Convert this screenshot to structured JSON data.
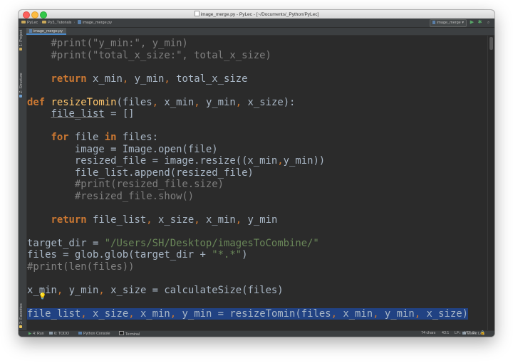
{
  "window": {
    "title": "image_merge.py - PyLec - [~/Documents/_Python/PyLec]"
  },
  "navbar": {
    "breadcrumbs": [
      "PyLec",
      "Py3_Tutorials",
      "image_merge.py"
    ],
    "run_config": "image_merge ▾",
    "run_icon": "run-icon",
    "debug_icon": "debug-icon",
    "search_icon": "search-icon"
  },
  "tabs": [
    {
      "label": "image_merge.py",
      "active": true
    }
  ],
  "left_tools": [
    {
      "label": "1: Project"
    },
    {
      "label": "Z: Structure"
    },
    {
      "label": "2: Favorites"
    }
  ],
  "editor": {
    "lines": [
      [
        [
          "cmt",
          "    #print(\"y_min:\", y_min)"
        ]
      ],
      [
        [
          "cmt",
          "    #print(\"total_x_size:\", total_x_size)"
        ]
      ],
      [
        [
          "plain",
          ""
        ]
      ],
      [
        [
          "plain",
          "    "
        ],
        [
          "kw",
          "return"
        ],
        [
          "plain",
          " x_min"
        ],
        [
          "kwn",
          ","
        ],
        [
          "plain",
          " y_min"
        ],
        [
          "kwn",
          ","
        ],
        [
          "plain",
          " total_x_size"
        ]
      ],
      [
        [
          "plain",
          ""
        ]
      ],
      [
        [
          "kw",
          "def"
        ],
        [
          "plain",
          " "
        ],
        [
          "fn",
          "resizeTomin"
        ],
        [
          "plain",
          "(files"
        ],
        [
          "kwn",
          ","
        ],
        [
          "plain",
          " x_min"
        ],
        [
          "kwn",
          ","
        ],
        [
          "plain",
          " y_min"
        ],
        [
          "kwn",
          ","
        ],
        [
          "plain",
          " x_size):"
        ]
      ],
      [
        [
          "plain",
          "    "
        ],
        [
          "unused",
          "file_list"
        ],
        [
          "plain",
          " = []"
        ]
      ],
      [
        [
          "plain",
          ""
        ]
      ],
      [
        [
          "plain",
          "    "
        ],
        [
          "kw",
          "for"
        ],
        [
          "plain",
          " file "
        ],
        [
          "kw",
          "in"
        ],
        [
          "plain",
          " files:"
        ]
      ],
      [
        [
          "plain",
          "        image = Image.open(file)"
        ]
      ],
      [
        [
          "plain",
          "        resized_file = image.resize((x_min"
        ],
        [
          "kwn",
          ","
        ],
        [
          "plain",
          "y_min))"
        ]
      ],
      [
        [
          "plain",
          "        file_list.append(resized_file)"
        ]
      ],
      [
        [
          "cmt",
          "        #print(resized_file.size)"
        ]
      ],
      [
        [
          "cmt",
          "        #resized_file.show()"
        ]
      ],
      [
        [
          "plain",
          ""
        ]
      ],
      [
        [
          "plain",
          "    "
        ],
        [
          "kw",
          "return"
        ],
        [
          "plain",
          " file_list"
        ],
        [
          "kwn",
          ","
        ],
        [
          "plain",
          " x_size"
        ],
        [
          "kwn",
          ","
        ],
        [
          "plain",
          " x_min"
        ],
        [
          "kwn",
          ","
        ],
        [
          "plain",
          " y_min"
        ]
      ],
      [
        [
          "plain",
          ""
        ]
      ],
      [
        [
          "plain",
          "target_dir = "
        ],
        [
          "str",
          "\"/Users/SH/Desktop/imagesToCombine/\""
        ]
      ],
      [
        [
          "plain",
          "files = glob.glob(target_dir + "
        ],
        [
          "str",
          "\"*.*\""
        ],
        [
          "plain",
          ")"
        ]
      ],
      [
        [
          "cmt",
          "#print(len(files))"
        ]
      ],
      [
        [
          "plain",
          ""
        ]
      ],
      [
        [
          "plain",
          "x_min"
        ],
        [
          "kwn",
          ","
        ],
        [
          "plain",
          " y_min"
        ],
        [
          "kwn",
          ","
        ],
        [
          "plain",
          " x_size = calculateSize(files)"
        ]
      ],
      [
        [
          "plain",
          ""
        ]
      ],
      [
        [
          "plain",
          "file_list"
        ],
        [
          "kwn",
          ","
        ],
        [
          "plain",
          " x_size"
        ],
        [
          "kwn",
          ","
        ],
        [
          "plain",
          " x_min"
        ],
        [
          "kwn",
          ","
        ],
        [
          "plain",
          " y_min = resizeTomin(files"
        ],
        [
          "kwn",
          ","
        ],
        [
          "plain",
          " x_min"
        ],
        [
          "kwn",
          ","
        ],
        [
          "plain",
          " y_min"
        ],
        [
          "kwn",
          ","
        ],
        [
          "plain",
          " x_size)"
        ]
      ]
    ],
    "highlighted_line": 23,
    "intention_icon": "lightbulb-icon"
  },
  "bottom_tools": [
    {
      "label": "4: Run",
      "icon": "run-icon"
    },
    {
      "label": "6: TODO",
      "icon": "todo-icon"
    },
    {
      "label": "Python Console",
      "icon": "python-console-icon"
    },
    {
      "label": "Terminal",
      "icon": "terminal-icon"
    }
  ],
  "event_log": "Event Log",
  "status": {
    "chars": "74 chars",
    "position": "43:1",
    "line_sep": "LF↕",
    "encoding": "UTF-8↕",
    "lock_icon": "lock-icon"
  },
  "colors": {
    "background": "#2b2b2b",
    "keyword": "#cc7832",
    "function": "#ffc66d",
    "string": "#6a8759",
    "comment": "#808080",
    "selection": "#214283"
  }
}
